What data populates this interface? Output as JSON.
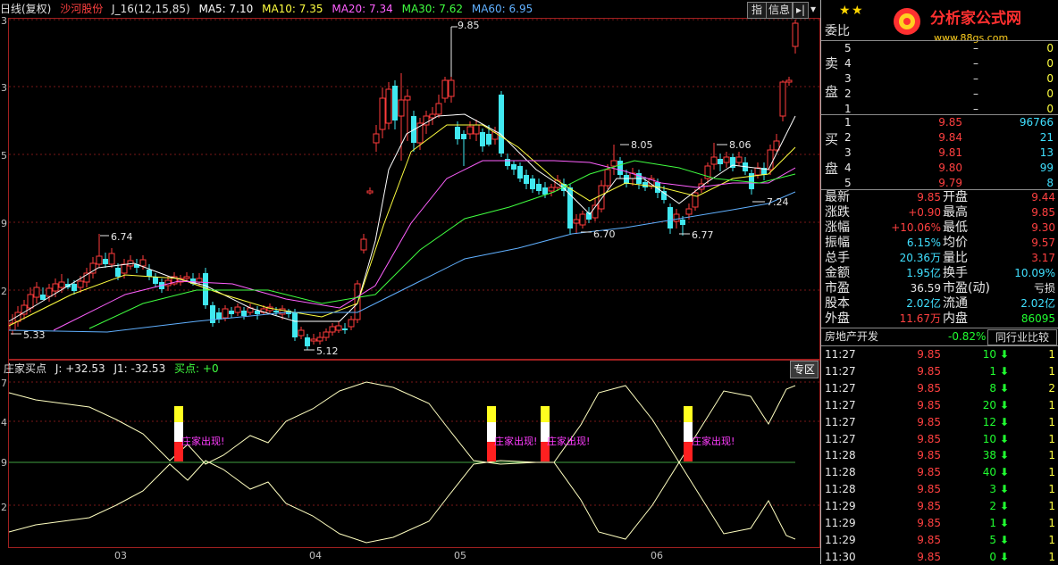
{
  "header": {
    "period": "日线(复权)",
    "stock_name": "沙河股份",
    "indicator": "J_16(12,15,85)",
    "ma": [
      {
        "label": "MA5: 7.10",
        "color": "#ffffff"
      },
      {
        "label": "MA10: 7.35",
        "color": "#ffff40"
      },
      {
        "label": "MA20: 7.34",
        "color": "#ff60ff"
      },
      {
        "label": "MA30: 7.62",
        "color": "#40ff40"
      },
      {
        "label": "MA60: 6.95",
        "color": "#60b0ff"
      }
    ],
    "buttons": {
      "zhi": "指",
      "info": "信息",
      "jump": "▸|",
      "menu": "▾"
    }
  },
  "price_labels": {
    "p985": "9.85",
    "p674": "6.74",
    "p533": "5.33",
    "p512": "5.12",
    "p805": "8.05",
    "p670": "6.70",
    "p677": "6.77",
    "p806": "8.06",
    "p724": "7.24"
  },
  "sub_chart": {
    "name": "庄家买点",
    "j": "J: +32.53",
    "j1": "J1: -32.53",
    "buy": "买点: +0",
    "zone_button": "专区",
    "signal_text": "庄家出现!"
  },
  "x_axis": [
    "03",
    "04",
    "05",
    "06"
  ],
  "y_axis_left": [
    "3",
    "3",
    "5",
    "9",
    "2",
    "7",
    "4",
    "9",
    "2"
  ],
  "logo": {
    "title": "分析家公式网",
    "url": "www.88gs.com"
  },
  "panel": {
    "weibi_label": "委比",
    "sell_label_1": "卖",
    "sell_label_2": "盘",
    "buy_label_1": "买",
    "buy_label_2": "盘",
    "sell": [
      {
        "level": "5",
        "price": "–",
        "vol": "0"
      },
      {
        "level": "4",
        "price": "–",
        "vol": "0"
      },
      {
        "level": "3",
        "price": "–",
        "vol": "0"
      },
      {
        "level": "2",
        "price": "–",
        "vol": "0"
      },
      {
        "level": "1",
        "price": "–",
        "vol": "0"
      }
    ],
    "buy": [
      {
        "level": "1",
        "price": "9.85",
        "vol": "96766"
      },
      {
        "level": "2",
        "price": "9.84",
        "vol": "21"
      },
      {
        "level": "3",
        "price": "9.81",
        "vol": "13"
      },
      {
        "level": "4",
        "price": "9.80",
        "vol": "99"
      },
      {
        "level": "5",
        "price": "9.79",
        "vol": "8"
      }
    ],
    "stats": [
      {
        "l1": "最新",
        "v1": "9.85",
        "c1": "#ff4040",
        "l2": "开盘",
        "v2": "9.44",
        "c2": "#ff4040"
      },
      {
        "l1": "涨跌",
        "v1": "+0.90",
        "c1": "#ff4040",
        "l2": "最高",
        "v2": "9.85",
        "c2": "#ff4040"
      },
      {
        "l1": "涨幅",
        "v1": "+10.06%",
        "c1": "#ff4040",
        "l2": "最低",
        "v2": "9.30",
        "c2": "#ff4040"
      },
      {
        "l1": "振幅",
        "v1": "6.15%",
        "c1": "#40e0ff",
        "l2": "均价",
        "v2": "9.57",
        "c2": "#ff4040"
      },
      {
        "l1": "总手",
        "v1": "20.36万",
        "c1": "#40e0ff",
        "l2": "量比",
        "v2": "3.17",
        "c2": "#ff4040"
      },
      {
        "l1": "金额",
        "v1": "1.95亿",
        "c1": "#40e0ff",
        "l2": "换手",
        "v2": "10.09%",
        "c2": "#40e0ff"
      },
      {
        "l1": "市盈",
        "v1": "36.59",
        "c1": "#e8e8e8",
        "l2": "市盈(动)",
        "v2": "亏损",
        "c2": "#e8e8e8"
      },
      {
        "l1": "股本",
        "v1": "2.02亿",
        "c1": "#40e0ff",
        "l2": "流通",
        "v2": "2.02亿",
        "c2": "#40e0ff"
      },
      {
        "l1": "外盘",
        "v1": "11.67万",
        "c1": "#ff4040",
        "l2": "内盘",
        "v2": "86095",
        "c2": "#20ff30"
      }
    ],
    "sector": {
      "name": "房地产开发",
      "change": "-0.82%",
      "compare_button": "同行业比较"
    },
    "ticks": [
      {
        "time": "11:27",
        "price": "9.85",
        "vol": "10",
        "n": "1"
      },
      {
        "time": "11:27",
        "price": "9.85",
        "vol": "1",
        "n": "1"
      },
      {
        "time": "11:27",
        "price": "9.85",
        "vol": "8",
        "n": "2"
      },
      {
        "time": "11:27",
        "price": "9.85",
        "vol": "20",
        "n": "1"
      },
      {
        "time": "11:27",
        "price": "9.85",
        "vol": "12",
        "n": "1"
      },
      {
        "time": "11:27",
        "price": "9.85",
        "vol": "10",
        "n": "1"
      },
      {
        "time": "11:28",
        "price": "9.85",
        "vol": "38",
        "n": "1"
      },
      {
        "time": "11:28",
        "price": "9.85",
        "vol": "40",
        "n": "1"
      },
      {
        "time": "11:28",
        "price": "9.85",
        "vol": "3",
        "n": "1"
      },
      {
        "time": "11:29",
        "price": "9.85",
        "vol": "2",
        "n": "1"
      },
      {
        "time": "11:29",
        "price": "9.85",
        "vol": "1",
        "n": "1"
      },
      {
        "time": "11:29",
        "price": "9.85",
        "vol": "5",
        "n": "1"
      },
      {
        "time": "11:30",
        "price": "9.85",
        "vol": "0",
        "n": "1"
      }
    ]
  }
}
